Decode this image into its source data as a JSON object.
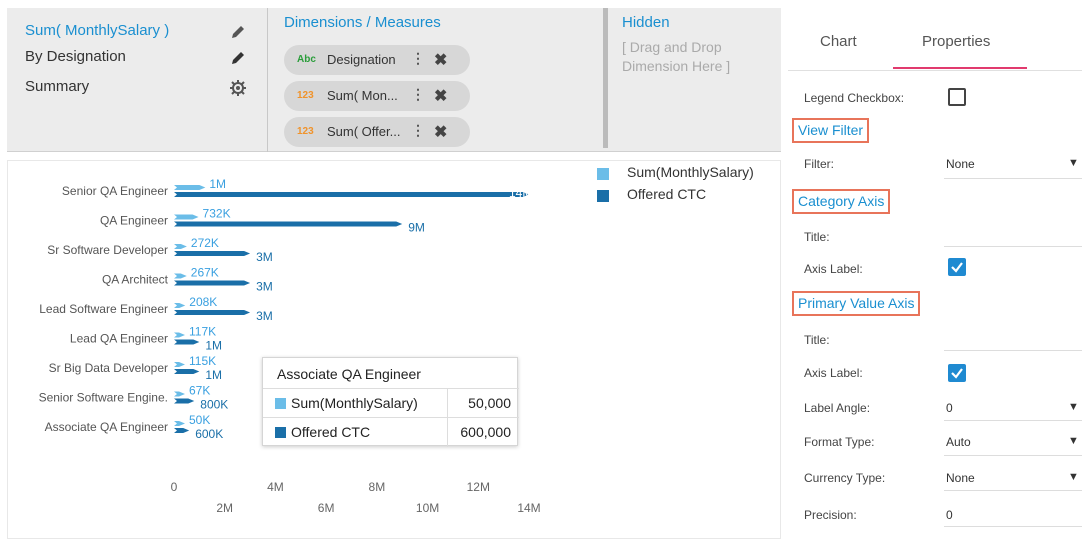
{
  "topbar": {
    "fields": [
      {
        "label": "Sum( MonthlySalary )",
        "icon": "pencil-icon",
        "color": "#1a8fd0"
      },
      {
        "label": "By Designation",
        "icon": "pencil-icon",
        "color": "#333333"
      },
      {
        "label": "Summary",
        "icon": "gear-icon",
        "color": "#333333"
      }
    ],
    "dimensions_title": "Dimensions / Measures",
    "pills": [
      {
        "tag": "Abc",
        "tag_color": "#2a9d3a",
        "label": "Designation"
      },
      {
        "tag": "123",
        "tag_color": "#f0932b",
        "label": "Sum( Mon..."
      },
      {
        "tag": "123",
        "tag_color": "#f0932b",
        "label": "Sum( Offer..."
      }
    ],
    "hidden_title": "Hidden",
    "hidden_hint": "[ Drag and Drop Dimension Here ]"
  },
  "tabs": {
    "chart": "Chart",
    "properties": "Properties"
  },
  "properties": {
    "legend_checkbox": "Legend Checkbox:",
    "view_filter": "View Filter",
    "filter_label": "Filter:",
    "filter_value": "None",
    "category_axis": "Category Axis",
    "cat_title": "Title:",
    "cat_axis_label": "Axis Label:",
    "primary_value_axis": "Primary Value Axis",
    "pv_title": "Title:",
    "pv_axis_label": "Axis Label:",
    "label_angle": "Label Angle:",
    "label_angle_value": "0",
    "format_type": "Format Type:",
    "format_type_value": "Auto",
    "currency_type": "Currency Type:",
    "currency_type_value": "None",
    "precision": "Precision:",
    "precision_value": "0"
  },
  "tooltip": {
    "title": "Associate QA Engineer",
    "rows": [
      {
        "name": "Sum(MonthlySalary)",
        "value": "50,000"
      },
      {
        "name": "Offered CTC",
        "value": "600,000"
      }
    ]
  },
  "colors": {
    "series1": "#6bbde8",
    "series2": "#1a6fa8"
  },
  "chart_data": {
    "type": "bar",
    "orientation": "horizontal",
    "categories": [
      "Senior QA Engineer",
      "QA Engineer",
      "Sr Software Developer",
      "QA Architect",
      "Lead Software Engineer",
      "Lead QA Engineer",
      "Sr Big Data Developer",
      "Senior Software Engine.",
      "Associate QA Engineer"
    ],
    "series": [
      {
        "name": "Sum(MonthlySalary)",
        "values": [
          1000000,
          732000,
          272000,
          267000,
          208000,
          117000,
          115000,
          67000,
          50000
        ],
        "labels": [
          "1M",
          "732K",
          "272K",
          "267K",
          "208K",
          "117K",
          "115K",
          "67K",
          "50K"
        ]
      },
      {
        "name": "Offered CTC",
        "values": [
          14000000,
          9000000,
          3000000,
          3000000,
          3000000,
          1000000,
          1000000,
          800000,
          600000
        ],
        "labels": [
          "14M",
          "9M",
          "3M",
          "3M",
          "3M",
          "1M",
          "1M",
          "800K",
          "600K"
        ]
      }
    ],
    "x_ticks_top": [
      "0",
      "4M",
      "8M",
      "12M"
    ],
    "x_ticks_bottom": [
      "2M",
      "6M",
      "10M",
      "14M"
    ],
    "xlim": [
      0,
      14000000
    ],
    "legend": "top-right"
  }
}
